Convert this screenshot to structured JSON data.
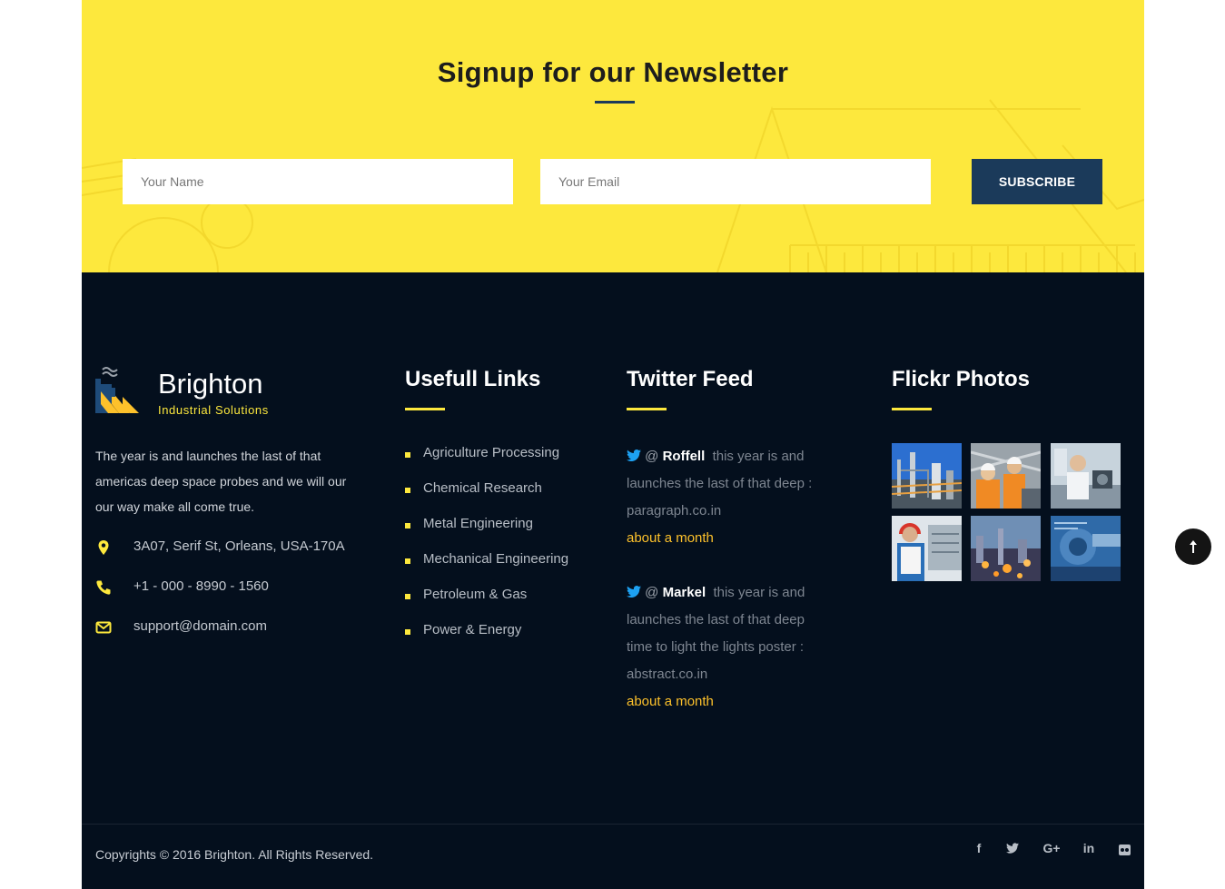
{
  "newsletter": {
    "title": "Signup for our Newsletter",
    "name_placeholder": "Your Name",
    "email_placeholder": "Your Email",
    "subscribe_label": "SUBSCRIBE"
  },
  "brand": {
    "name": "Brighton",
    "tagline": "Industrial Solutions",
    "about": "The year is and launches the last of that americas deep space probes and we will our our way make all come true."
  },
  "contact": {
    "address": "3A07, Serif St, Orleans, USA-170A",
    "phone": "+1 - 000 - 8990 - 1560",
    "email": "support@domain.com"
  },
  "links": {
    "title": "Usefull Links",
    "items": [
      "Agriculture Processing",
      "Chemical Research",
      "Metal Engineering",
      "Mechanical Engineering",
      "Petroleum & Gas",
      "Power & Energy"
    ]
  },
  "twitter": {
    "title": "Twitter Feed",
    "tweets": [
      {
        "at": "@",
        "handle": "Roffell",
        "text": "this year is and launches the last of that deep : paragraph.co.in",
        "time": "about a month"
      },
      {
        "at": "@",
        "handle": "Markel",
        "text": "this year is and launches the last of that deep time to light the lights poster : abstract.co.in",
        "time": "about a month"
      }
    ]
  },
  "flickr": {
    "title": "Flickr Photos"
  },
  "footer": {
    "copyright": "Copyrights © 2016 Brighton. All Rights Reserved.",
    "social": [
      {
        "icon": "facebook-icon",
        "glyph": "f"
      },
      {
        "icon": "twitter-icon",
        "glyph": ""
      },
      {
        "icon": "google-plus-icon",
        "glyph": "G+"
      },
      {
        "icon": "linkedin-icon",
        "glyph": "in"
      },
      {
        "icon": "flickr-icon",
        "glyph": ""
      }
    ]
  },
  "colors": {
    "accent_yellow": "#fde83d",
    "navy_button": "#1b3a5a",
    "footer_bg": "#040f1d",
    "tweet_time": "#fdc12b"
  }
}
